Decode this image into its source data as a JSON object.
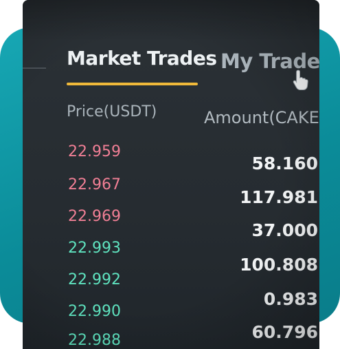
{
  "tabs": {
    "market_trades": "Market Trades",
    "my_trades": "My Trades"
  },
  "columns": {
    "price": "Price(USDT)",
    "amount": "Amount(CAKE)"
  },
  "trades": [
    {
      "price": "22.959",
      "amount": "58.160",
      "side": "sell"
    },
    {
      "price": "22.967",
      "amount": "117.981",
      "side": "sell"
    },
    {
      "price": "22.969",
      "amount": "37.000",
      "side": "sell"
    },
    {
      "price": "22.993",
      "amount": "100.808",
      "side": "buy"
    },
    {
      "price": "22.992",
      "amount": "0.983",
      "side": "buy"
    },
    {
      "price": "22.990",
      "amount": "60.796",
      "side": "buy"
    },
    {
      "price": "22.988",
      "amount": "",
      "side": "buy"
    }
  ],
  "colors": {
    "accent": "#f0b93a",
    "sell": "#f07f95",
    "buy": "#5fe3bf",
    "background": "#0b8c99"
  },
  "icons": {
    "cursor": "hand-pointer-icon"
  }
}
